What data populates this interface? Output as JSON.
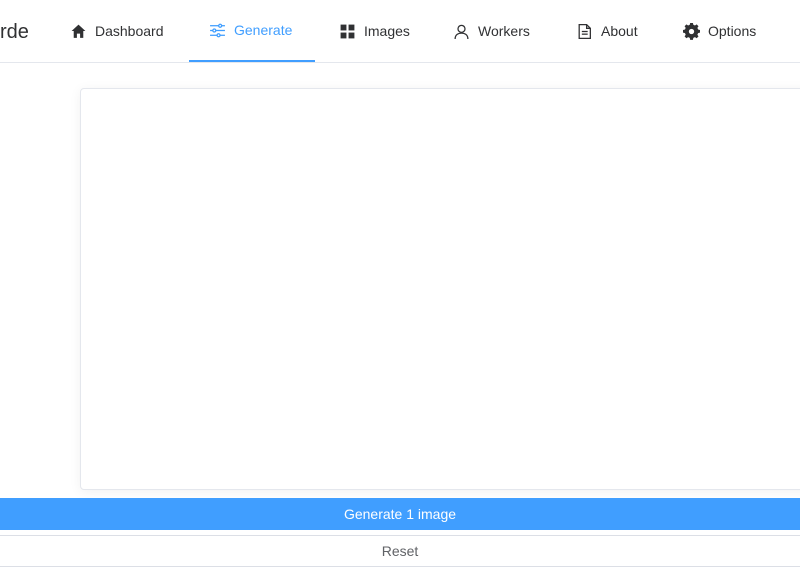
{
  "header": {
    "brand": "rde",
    "nav": [
      {
        "label": "Dashboard",
        "icon": "home-icon"
      },
      {
        "label": "Generate",
        "icon": "sliders-icon",
        "active": true
      },
      {
        "label": "Images",
        "icon": "grid-icon"
      },
      {
        "label": "Workers",
        "icon": "user-icon"
      },
      {
        "label": "About",
        "icon": "document-icon"
      },
      {
        "label": "Options",
        "icon": "gear-icon"
      }
    ]
  },
  "actions": {
    "generate_label": "Generate 1 image",
    "reset_label": "Reset"
  },
  "colors": {
    "accent": "#409eff",
    "text": "#303133",
    "border": "#e4e7ed"
  }
}
